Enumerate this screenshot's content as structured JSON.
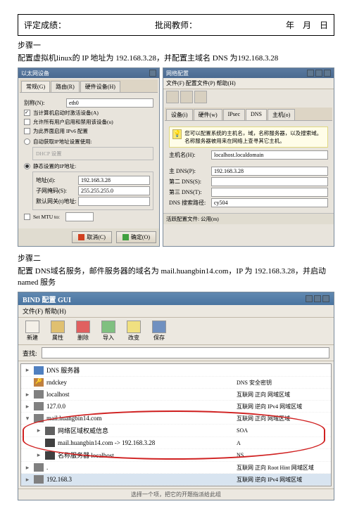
{
  "header": {
    "grade": "评定成绩：",
    "teacher": "批阅教师：",
    "date_y": "年",
    "date_m": "月",
    "date_d": "日"
  },
  "step1": {
    "title": "步骤一",
    "desc": "配置虚拟机linux的 IP 地址为 192.168.3.28，并配置主域名 DNS 为192.168.3.28"
  },
  "eth_win": {
    "title": "以太网设备",
    "tabs": [
      "常规(G)",
      "路由(R)",
      "硬件设备(H)"
    ],
    "nickname_label": "别称(N):",
    "nickname": "eth0",
    "cb1": "当计算机启动时激活设备(A)",
    "cb2": "允许所有用户启用和禁用该设备(u)",
    "cb3": "为此界面启用 IPv6 配置",
    "radio1": "自动获取IP地址设置使用:",
    "dhcp_section": "DHCP 设置",
    "radio2": "静态设置的IP地址:",
    "addr_label": "地址(d):",
    "addr": "192.168.3.28",
    "mask_label": "子网掩码(S):",
    "mask": "255.255.255.0",
    "gw_label": "默认网关(t)地址:",
    "gw": "",
    "mtu_cb": "Set MTU to:",
    "cancel": "取消(C)",
    "ok": "确定(O)"
  },
  "net_win": {
    "title": "网络配置",
    "menu": "文件(F)  配置文件(P)  帮助(H)",
    "tabs": [
      "设备(i)",
      "硬件(w)",
      "IPsec",
      "DNS",
      "主机(o)"
    ],
    "info": "您可以配置系统的主机名，域，名称服务器，以及搜索域。名称服务器被用来在网络上查寻其它主机。",
    "hostname_label": "主机名(H):",
    "hostname": "localhost.localdomain",
    "dns1_label": "主 DNS(P):",
    "dns1": "192.168.3.28",
    "dns2_label": "第二 DNS(S):",
    "dns3_label": "第三 DNS(T):",
    "search_label": "DNS 搜索路径:",
    "search": "cy504",
    "status": "活跃配置文件: 公用(m)"
  },
  "step2": {
    "title": "步骤二",
    "desc": "配置 DNS域名服务，邮件服务器的域名为 mail.huangbin14.com，IP 为 192.168.3.28，并启动 named 服务"
  },
  "bind": {
    "title": "BIND 配置 GUI",
    "menu": "文件(F)  帮助(H)",
    "tools": [
      "新建",
      "属性",
      "删除",
      "导入",
      "改变",
      "保存"
    ],
    "search_label": "查找:",
    "rows": [
      {
        "exp": "▸",
        "name": "DNS 服务器",
        "type": "",
        "iconcolor": "#5080c0"
      },
      {
        "exp": "",
        "name": "rndckey",
        "type": "DNS 安全密钥",
        "iconcolor": "#c08040",
        "icontext": "🔑"
      },
      {
        "exp": "▸",
        "name": "localhost",
        "type": "互联网 正向 网域区域",
        "iconcolor": "#808080"
      },
      {
        "exp": "▸",
        "name": "127.0.0",
        "type": "互联网 逆向 IPv4 网域区域",
        "iconcolor": "#808080"
      },
      {
        "exp": "▾",
        "name": "mail.huangbin14.com",
        "type": "互联网 正向 网域区域",
        "iconcolor": "#808080",
        "circled": true
      },
      {
        "exp": "▸",
        "name": "网络区域权威信息",
        "type": "SOA",
        "iconcolor": "#606060",
        "indent": true,
        "circled": true
      },
      {
        "exp": "",
        "name": "mail.huangbin14.com -> 192.168.3.28",
        "type": "A",
        "iconcolor": "#404040",
        "indent": true,
        "circled": true
      },
      {
        "exp": "▸",
        "name": "名称服务器 localhost",
        "type": "NS",
        "iconcolor": "#404040",
        "indent": true,
        "circled": true
      },
      {
        "exp": "▸",
        "name": ".",
        "type": "互联网 正向 Root Hint 网域区域",
        "iconcolor": "#808080"
      },
      {
        "exp": "▸",
        "name": "192.168.3",
        "type": "互联网 逆向 IPv4 网域区域",
        "iconcolor": "#808080",
        "sel": true
      }
    ],
    "status": "选择一个项，把它的开题指派给此组"
  }
}
